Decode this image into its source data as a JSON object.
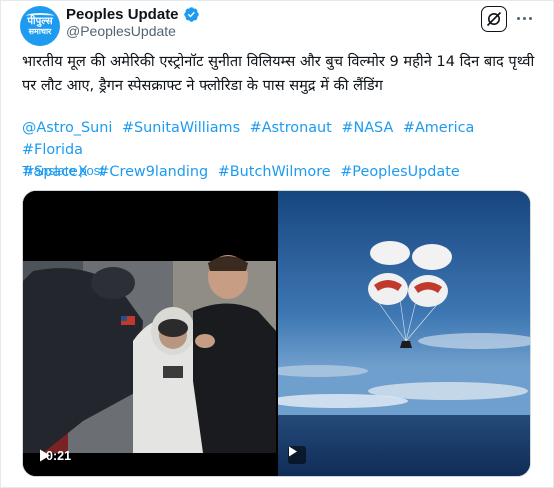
{
  "account": {
    "display_name": "Peoples Update",
    "handle": "@PeoplesUpdate",
    "avatar_line1": "पीपुल्स",
    "avatar_line2": "समाचार",
    "verified_icon": "verified-badge-icon",
    "verified_color": "#1d9bf0"
  },
  "actions": {
    "grok_icon": "grok-icon",
    "more_icon": "more-options-icon"
  },
  "tweet": {
    "text": "भारतीय मूल की अमेरिकी एस्ट्रोनॉट सुनीता विलियम्स और बुच विल्मोर 9 महीने 14 दिन बाद पृथ्वी पर लौट आए, ड्रैगन स्पेसक्राफ्ट ने फ्लोरिडा के पास समुद्र में की लैंडिंग",
    "hashtags": [
      "@Astro_Suni",
      "#SunitaWilliams",
      "#Astronaut",
      "#NASA",
      "#America",
      "#Florida",
      "#SpaceX",
      "#Crew9landing",
      "#ButchWilmore",
      "#PeoplesUpdate"
    ],
    "translate_label": "Translate post"
  },
  "media": {
    "left_video": {
      "duration": "0:21",
      "play_icon": "play-icon"
    },
    "right_video": {
      "play_icon": "play-icon"
    }
  },
  "colors": {
    "link": "#1d9bf0",
    "text": "#0f1419",
    "secondary": "#536471",
    "border": "#cfd9de"
  }
}
